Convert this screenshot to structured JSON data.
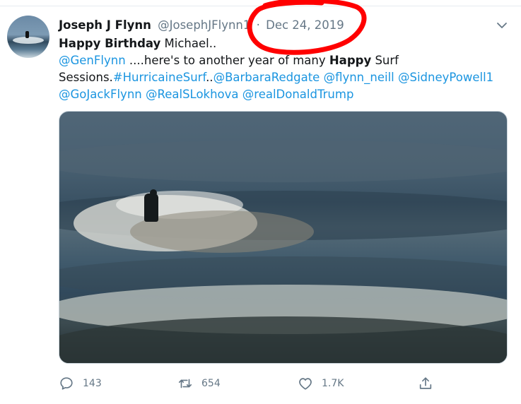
{
  "author": {
    "display_name": "Joseph J Flynn",
    "handle": "@JosephJFlynn1",
    "separator": "·",
    "date": "Dec 24, 2019"
  },
  "tweet": {
    "line1_bold": "Happy Birthday",
    "line1_rest": " Michael..",
    "line2_mention": "@GenFlynn",
    "line2_text": " ....here's to another year of many ",
    "line2_bold": "Happy",
    "line2_end": " Surf",
    "line3_text": "Sessions.",
    "line3_hashtag": "#HurricaineSurf",
    "line3_sep": "..",
    "line3_mention1": "@BarbaraRedgate",
    "line3_mention2": "@flynn_neill",
    "line3_mention3": "@SidneyPowell1",
    "line4_mention1": "@GoJackFlynn",
    "line4_mention2": "@RealSLokhova",
    "line4_mention3": "@realDonaldTrump"
  },
  "actions": {
    "replies": "143",
    "retweets": "654",
    "likes": "1.7K"
  },
  "colors": {
    "link": "#1b95e0",
    "secondary_text": "#657786",
    "annotation": "#ff0000"
  },
  "icons": [
    "reply-icon",
    "retweet-icon",
    "like-icon",
    "share-icon",
    "chevron-down-icon"
  ]
}
